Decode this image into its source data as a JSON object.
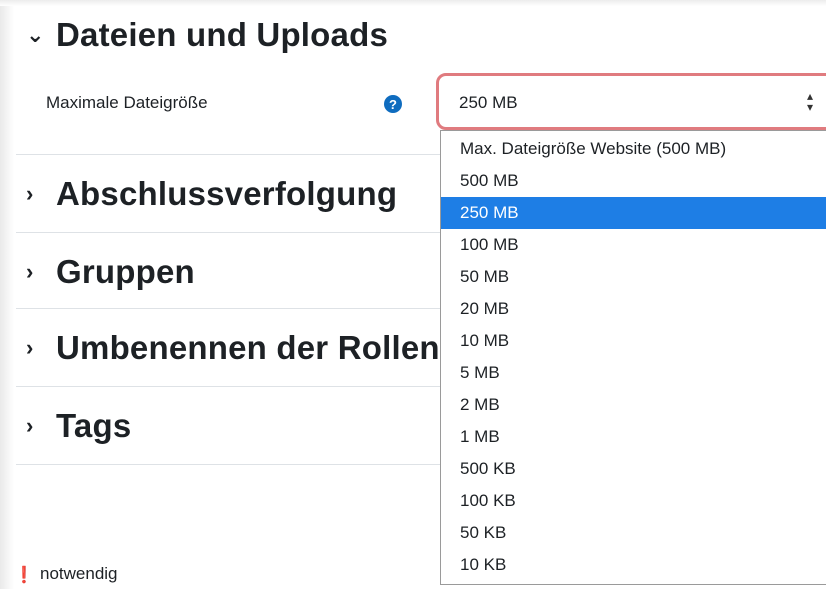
{
  "sections": [
    {
      "title": "Dateien und Uploads",
      "icon": "chevron-down-icon",
      "expanded": true
    },
    {
      "title": "Abschlussverfolgung",
      "icon": "chevron-right-icon",
      "expanded": false
    },
    {
      "title": "Gruppen",
      "icon": "chevron-right-icon",
      "expanded": false
    },
    {
      "title": "Umbenennen der Rollen",
      "icon": "chevron-right-icon",
      "expanded": false
    },
    {
      "title": "Tags",
      "icon": "chevron-right-icon",
      "expanded": false
    }
  ],
  "field": {
    "label": "Maximale Dateigröße",
    "help_icon": "question-circle-icon",
    "value": "250 MB"
  },
  "dropdown": {
    "selected_index": 2,
    "options": [
      "Max. Dateigröße Website (500 MB)",
      "500 MB",
      "250 MB",
      "100 MB",
      "50 MB",
      "20 MB",
      "10 MB",
      "5 MB",
      "2 MB",
      "1 MB",
      "500 KB",
      "100 KB",
      "50 KB",
      "10 KB"
    ]
  },
  "required": {
    "icon": "exclamation-circle-icon",
    "text": "notwendig"
  },
  "colors": {
    "select_border": "#e07b7f",
    "selected_option_bg": "#1e7ee5",
    "help_icon_bg": "#0f6cbf",
    "required_icon": "#c0392b"
  }
}
